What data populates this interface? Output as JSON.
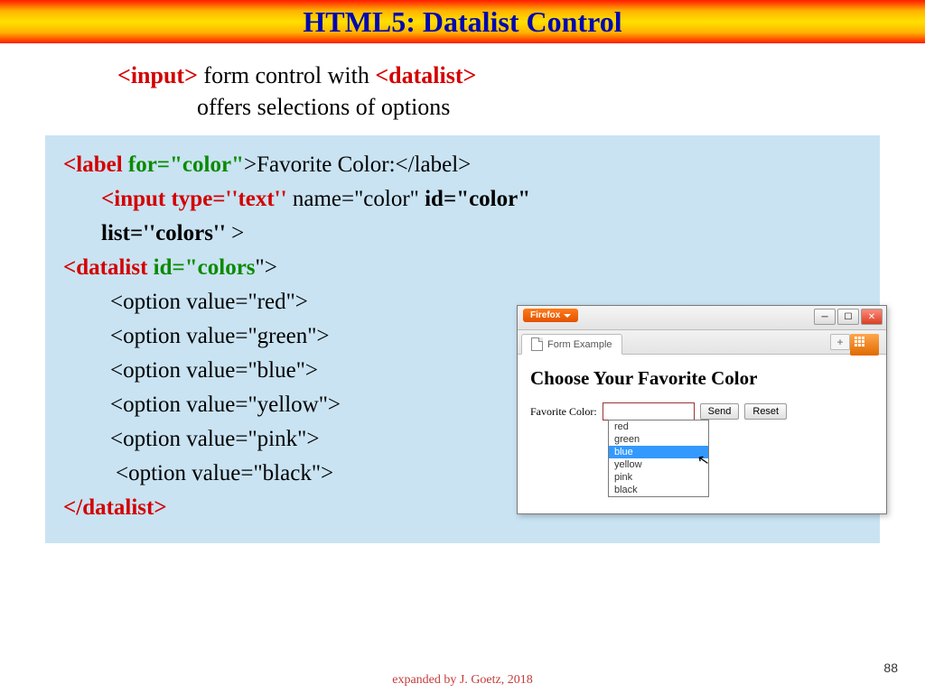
{
  "title": "HTML5: Datalist Control",
  "subtitle": {
    "input_tag": "<input>",
    "mid1": " form control with ",
    "datalist_tag": "<datalist>",
    "line2": "offers selections of options"
  },
  "code": {
    "l1_a": "<label ",
    "l1_b": "for=\"color\"",
    "l1_c": ">Favorite Color:</label>",
    "l2_a": "<input type=''text'' ",
    "l2_b": "name=\"color\" ",
    "l2_c": "id=\"color\" ",
    "l3_a": "list=''colors'' ",
    "l3_b": ">",
    "l4_a": "<datalist ",
    "l4_b": "id=\"colors",
    "l4_c": "\">",
    "opt1": "<option value=\"red\">",
    "opt2": "<option value=\"green\">",
    "opt3": "<option value=\"blue\">",
    "opt4": "<option value=\"yellow\">",
    "opt5": "<option value=\"pink\">",
    "opt6": "<option value=\"black\">",
    "close": "</datalist>"
  },
  "browser": {
    "firefox_label": "Firefox",
    "tab_label": "Form Example",
    "heading": "Choose Your Favorite Color",
    "form_label": "Favorite Color:",
    "send": "Send",
    "reset": "Reset",
    "options": [
      "red",
      "green",
      "blue",
      "yellow",
      "pink",
      "black"
    ],
    "selected_index": 2
  },
  "footer": "expanded  by J. Goetz, 2018",
  "page_number": "88"
}
